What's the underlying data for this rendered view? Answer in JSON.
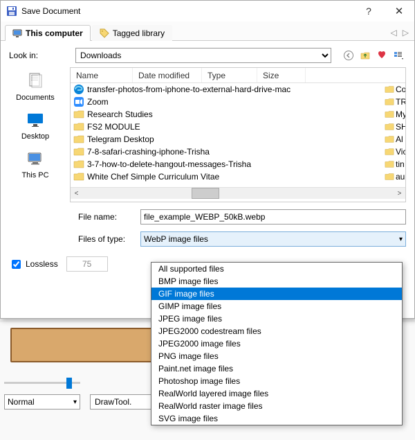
{
  "titlebar": {
    "title": "Save Document"
  },
  "tabs": {
    "this_computer": "This computer",
    "tagged_library": "Tagged library"
  },
  "look_in": {
    "label": "Look in:",
    "value": "Downloads"
  },
  "columns": {
    "name": "Name",
    "date": "Date modified",
    "type": "Type",
    "size": "Size"
  },
  "places": {
    "documents": "Documents",
    "desktop": "Desktop",
    "thispc": "This PC"
  },
  "files": [
    "transfer-photos-from-iphone-to-external-hard-drive-mac",
    "Zoom",
    "Research Studies",
    "FS2 MODULE",
    "Telegram Desktop",
    "7-8-safari-crashing-iphone-Trisha",
    "3-7-how-to-delete-hangout-messages-Trisha",
    "White Chef Simple Curriculum Vitae"
  ],
  "rightcol": [
    "Co",
    "TR",
    "My",
    "SH",
    "Al",
    "Vic",
    "tin",
    "au"
  ],
  "filename": {
    "label": "File name:",
    "value": "file_example_WEBP_50kB.webp"
  },
  "filetype": {
    "label": "Files of type:",
    "selected": "WebP image files"
  },
  "lossless": {
    "label": "Lossless",
    "quality": "75"
  },
  "dropdown": [
    "All supported files",
    "BMP image files",
    "GIF image files",
    "GIMP image files",
    "JPEG image files",
    "JPEG2000 codestream files",
    "JPEG2000 image files",
    "PNG image files",
    "Paint.net image files",
    "Photoshop image files",
    "RealWorld layered image files",
    "RealWorld raster image files",
    "SVG image files"
  ],
  "dropdown_selected_index": 2,
  "bg": {
    "mode": "Normal",
    "code": "DrawTool."
  }
}
